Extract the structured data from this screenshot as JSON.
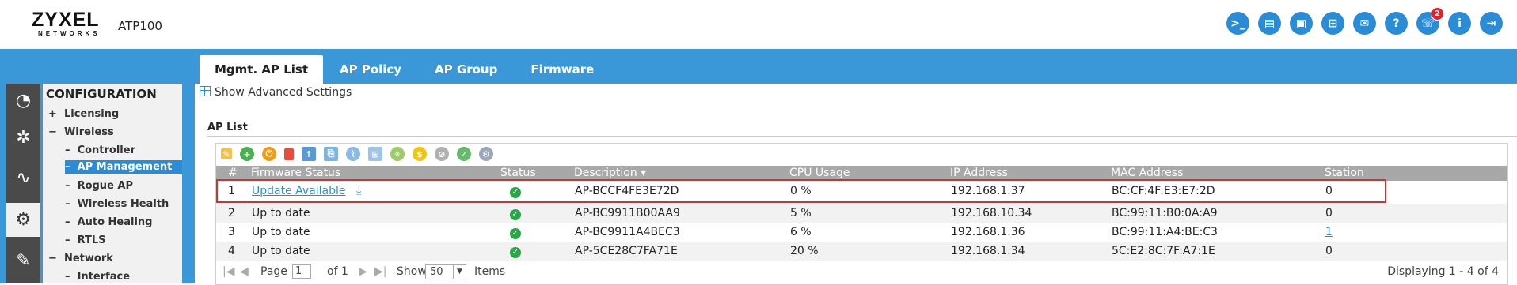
{
  "header": {
    "logo_text": "ZYXEL",
    "logo_sub": "NETWORKS",
    "model": "ATP100",
    "icons": [
      {
        "name": "console-icon",
        "glyph": ">_"
      },
      {
        "name": "cli-icon",
        "glyph": "▤"
      },
      {
        "name": "window-icon",
        "glyph": "▣"
      },
      {
        "name": "topology-icon",
        "glyph": "⊞"
      },
      {
        "name": "chat-icon",
        "glyph": "✉"
      },
      {
        "name": "help-icon",
        "glyph": "?"
      },
      {
        "name": "notification-icon",
        "glyph": "☏",
        "badge": "2"
      },
      {
        "name": "info-icon",
        "glyph": "i"
      },
      {
        "name": "logout-icon",
        "glyph": "⇥"
      }
    ]
  },
  "tabs": [
    "Mgmt. AP List",
    "AP Policy",
    "AP Group",
    "Firmware"
  ],
  "active_tab": 0,
  "sidebar": {
    "title": "CONFIGURATION",
    "items": [
      {
        "label": "Licensing",
        "prefix": "+"
      },
      {
        "label": "Wireless",
        "prefix": "−"
      },
      {
        "label": "Controller",
        "prefix": "–"
      },
      {
        "label": "AP Management",
        "prefix": "–",
        "active": true
      },
      {
        "label": "Rogue AP",
        "prefix": "–"
      },
      {
        "label": "Wireless Health",
        "prefix": "–"
      },
      {
        "label": "Auto Healing",
        "prefix": "–"
      },
      {
        "label": "RTLS",
        "prefix": "–"
      },
      {
        "label": "Network",
        "prefix": "−"
      },
      {
        "label": "Interface",
        "prefix": "–"
      }
    ]
  },
  "advanced_settings": "Show Advanced Settings",
  "ap_list": {
    "title": "AP List",
    "columns": [
      "#",
      "Firmware Status",
      "Status",
      "Description ▾",
      "CPU Usage",
      "IP Address",
      "MAC Address",
      "Station"
    ],
    "rows": [
      {
        "num": "1",
        "firmware": "Update Available",
        "cpu": "0 %",
        "desc": "AP-BCCF4FE3E72D",
        "ip": "192.168.1.37",
        "mac": "BC:CF:4F:E3:E7:2D",
        "station": "0"
      },
      {
        "num": "2",
        "firmware": "Up to date",
        "cpu": "5 %",
        "desc": "AP-BC9911B00AA9",
        "ip": "192.168.10.34",
        "mac": "BC:99:11:B0:0A:A9",
        "station": "0"
      },
      {
        "num": "3",
        "firmware": "Up to date",
        "cpu": "6 %",
        "desc": "AP-BC9911A4BEC3",
        "ip": "192.168.1.36",
        "mac": "BC:99:11:A4:BE:C3",
        "station": "1"
      },
      {
        "num": "4",
        "firmware": "Up to date",
        "cpu": "20 %",
        "desc": "AP-5CE28C7FA71E",
        "ip": "192.168.1.34",
        "mac": "5C:E2:8C:7F:A7:1E",
        "station": "0"
      }
    ]
  },
  "pager": {
    "page_label": "Page",
    "page_value": "1",
    "of_label": "of 1",
    "show_label": "Show",
    "show_value": "50",
    "items_label": "Items",
    "displaying": "Displaying 1 - 4 of 4"
  },
  "colors": {
    "accent": "#3a97d8",
    "highlight": "#d9302c",
    "ok": "#27a745"
  }
}
